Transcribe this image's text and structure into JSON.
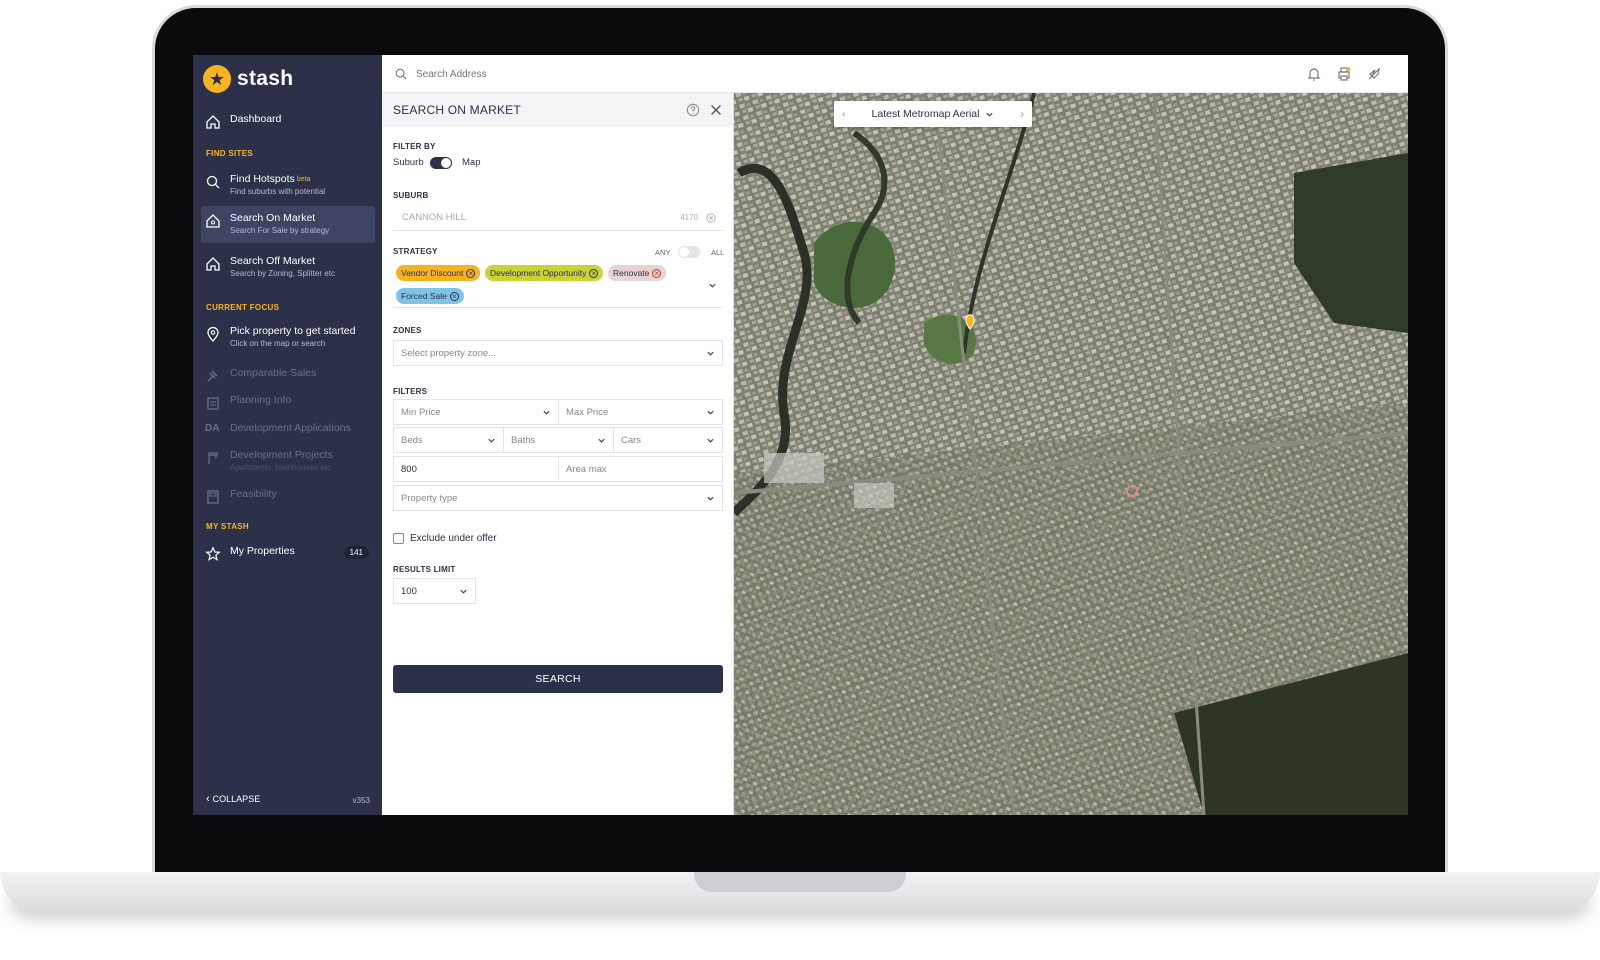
{
  "app": {
    "name": "stash",
    "version": "v353"
  },
  "sidebar": {
    "dashboard": "Dashboard",
    "sections": {
      "find_sites": "FIND SITES",
      "current_focus": "CURRENT FOCUS",
      "my_stash": "MY STASH"
    },
    "find_hotspots": {
      "title": "Find Hotspots",
      "badge": "beta",
      "sub": "Find suburbs with potential"
    },
    "search_on_market": {
      "title": "Search On Market",
      "sub": "Search For Sale by strategy"
    },
    "search_off_market": {
      "title": "Search Off Market",
      "sub": "Search by Zoning, Splitter etc"
    },
    "pick_property": {
      "title": "Pick property to get started",
      "sub": "Click on the map or search"
    },
    "comparable_sales": "Comparable Sales",
    "planning_info": "Planning Info",
    "development_applications": "Development Applications",
    "development_projects": {
      "title": "Development Projects",
      "sub": "Apartments, townhouses etc"
    },
    "feasibility": "Feasibility",
    "my_properties": {
      "title": "My Properties",
      "count": "141"
    },
    "collapse": "COLLAPSE",
    "da_label": "DA"
  },
  "topbar": {
    "search_placeholder": "Search Address"
  },
  "panel": {
    "title": "SEARCH ON MARKET",
    "filter_by": {
      "label": "FILTER BY",
      "left": "Suburb",
      "right": "Map"
    },
    "suburb": {
      "label": "SUBURB",
      "value": "CANNON HILL",
      "postcode": "4170"
    },
    "strategy": {
      "label": "STRATEGY",
      "any": "ANY",
      "all": "ALL",
      "chips": [
        "Vendor Discount",
        "Development Opportunity",
        "Renovate",
        "Forced Sale"
      ]
    },
    "zones": {
      "label": "ZONES",
      "placeholder": "Select property zone..."
    },
    "filters": {
      "label": "FILTERS",
      "min_price": "Min Price",
      "max_price": "Max Price",
      "beds": "Beds",
      "baths": "Baths",
      "cars": "Cars",
      "area_min": "800",
      "area_max": "Area max",
      "property_type": "Property type"
    },
    "exclude_under_offer": "Exclude under offer",
    "results_limit": {
      "label": "RESULTS LIMIT",
      "value": "100"
    },
    "search_button": "SEARCH"
  },
  "map": {
    "layer": "Latest Metromap Aerial"
  },
  "colors": {
    "sidebar": "#2c3149",
    "accent": "#f6b51e",
    "chip_vendor": "#f5b324",
    "chip_development": "#c8d335",
    "chip_renovate": "#e8d2d2",
    "chip_forced": "#7fc3e8"
  }
}
